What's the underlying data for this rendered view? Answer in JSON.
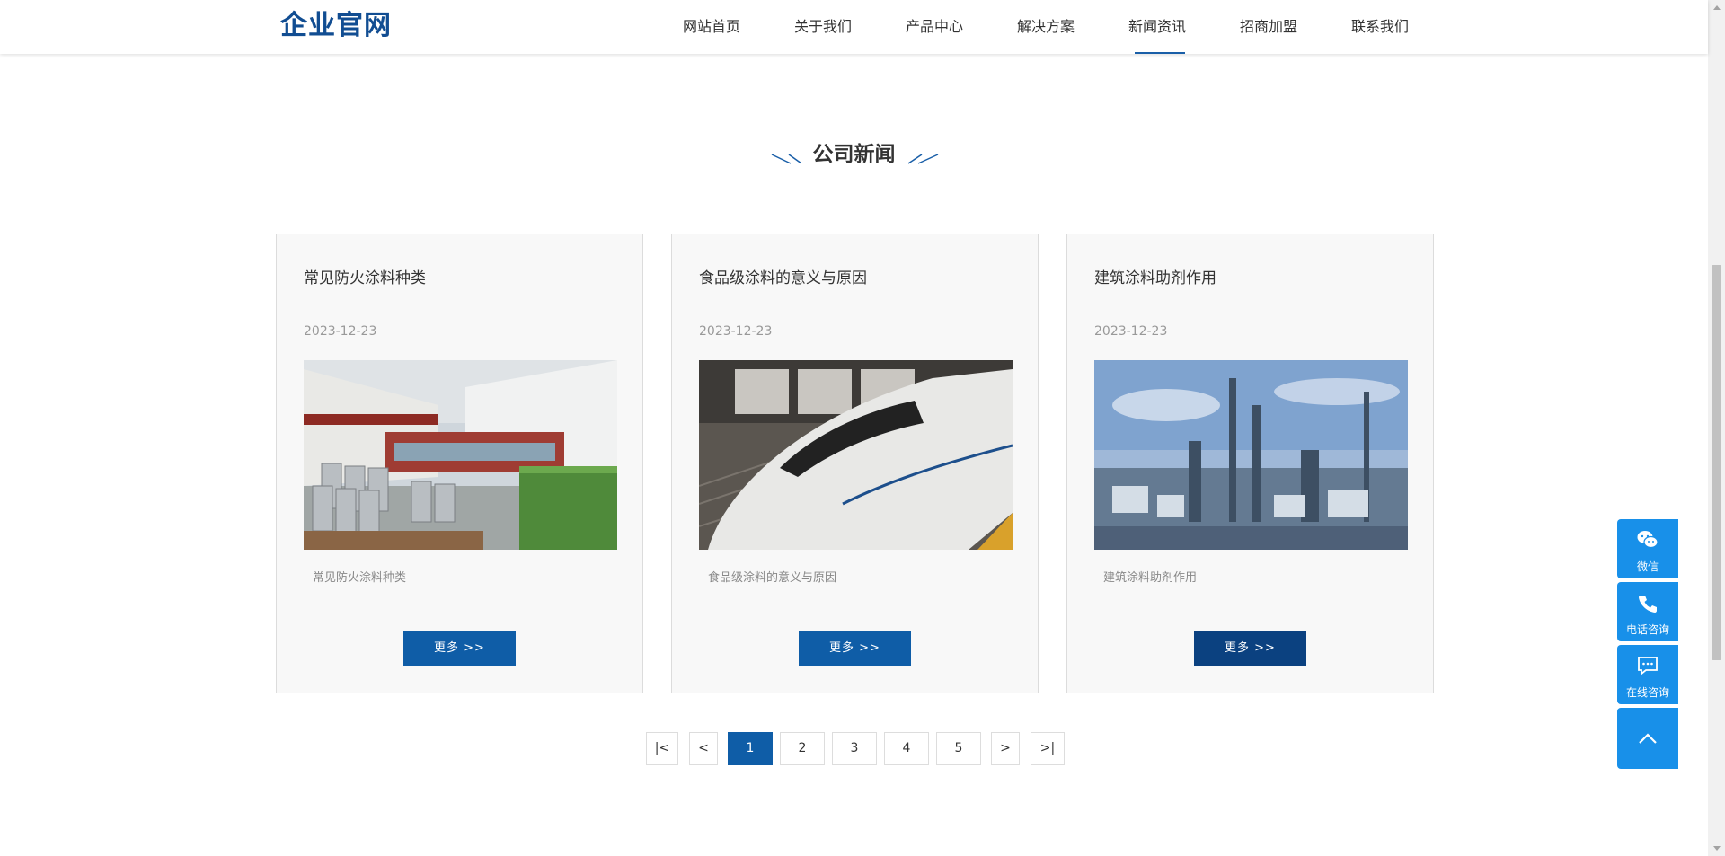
{
  "header": {
    "logo": "企业官网",
    "nav": [
      {
        "label": "网站首页"
      },
      {
        "label": "关于我们"
      },
      {
        "label": "产品中心"
      },
      {
        "label": "解决方案"
      },
      {
        "label": "新闻资讯",
        "active": true
      },
      {
        "label": "招商加盟"
      },
      {
        "label": "联系我们"
      }
    ]
  },
  "section": {
    "title": "公司新闻",
    "accent_color": "#1a5fa8"
  },
  "cards": [
    {
      "title": "常见防火涂料种类",
      "date": "2023-12-23",
      "image": "warehouse-barrels-photo",
      "desc": "常见防火涂料种类",
      "button": "更多 >>"
    },
    {
      "title": "食品级涂料的意义与原因",
      "date": "2023-12-23",
      "image": "bullet-train-photo",
      "desc": "食品级涂料的意义与原因",
      "button": "更多 >>"
    },
    {
      "title": "建筑涂料助剂作用",
      "date": "2023-12-23",
      "image": "refinery-plant-photo",
      "desc": "建筑涂料助剂作用",
      "button": "更多 >>"
    }
  ],
  "pagination": {
    "first": "|<",
    "prev": "<",
    "pages": [
      "1",
      "2",
      "3",
      "4",
      "5"
    ],
    "current": "1",
    "next": ">",
    "last": ">|"
  },
  "float_bar": {
    "wechat": "微信",
    "phone": "电话咨询",
    "online": "在线咨询",
    "top_icon": "chevron-up-icon",
    "color": "#1890e9"
  },
  "colors": {
    "brand": "#114d92",
    "button": "#0f5da7"
  }
}
